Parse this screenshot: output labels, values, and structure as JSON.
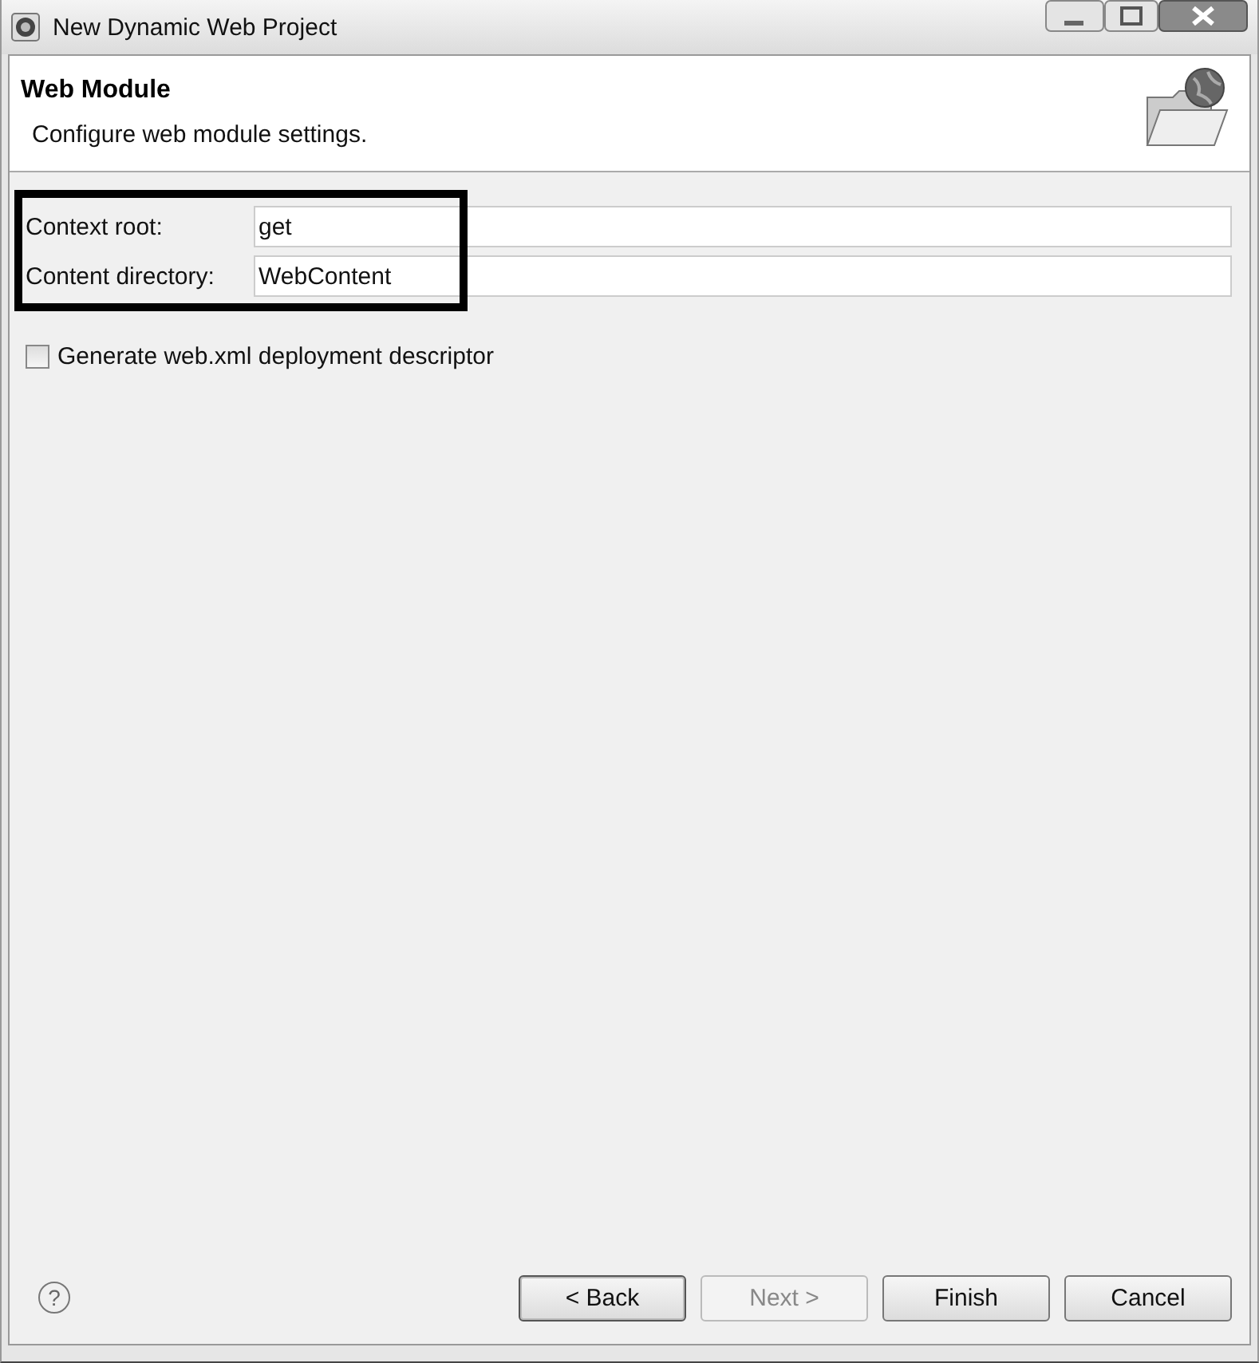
{
  "window": {
    "title": "New Dynamic Web Project"
  },
  "header": {
    "title": "Web Module",
    "description": "Configure web module settings."
  },
  "fields": [
    {
      "label": "Context root:",
      "value": "get"
    },
    {
      "label": "Content directory:",
      "value": "WebContent"
    }
  ],
  "checkbox": {
    "label": "Generate web.xml deployment descriptor",
    "checked": false
  },
  "help": "?",
  "buttons": [
    {
      "label": "< Back",
      "disabled": false,
      "selected": true
    },
    {
      "label": "Next >",
      "disabled": true,
      "selected": false
    },
    {
      "label": "Finish",
      "disabled": false,
      "selected": false
    },
    {
      "label": "Cancel",
      "disabled": false,
      "selected": false
    }
  ]
}
